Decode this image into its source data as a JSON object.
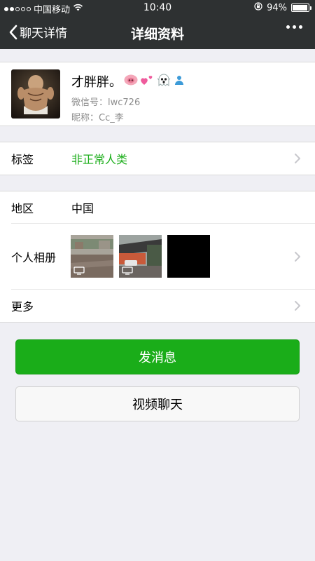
{
  "status_bar": {
    "carrier": "中国移动",
    "time": "10:40",
    "battery": "94%",
    "battery_level": 0.94,
    "signal_dots_filled": 2,
    "signal_dots_total": 5,
    "icons": [
      "signal-dots-icon",
      "wifi-icon",
      "orientation-lock-icon",
      "battery-icon"
    ]
  },
  "nav": {
    "back_label": "聊天详情",
    "title": "详细资料",
    "more_icon": "more-dots-icon"
  },
  "profile": {
    "name": "才胖胖。",
    "name_emojis": [
      "pig-nose-emoji",
      "two-hearts-emoji",
      "ghost-emoji",
      "gender-icon"
    ],
    "wechat_id_label": "微信号：",
    "wechat_id": "lwc726",
    "nickname_label": "昵称：",
    "nickname": "Cc_李"
  },
  "tag_row": {
    "label": "标签",
    "value": "非正常人类"
  },
  "details": {
    "region_label": "地区",
    "region_value": "中国",
    "album_label": "个人相册",
    "album_thumbnails": [
      "photo-street-rain",
      "photo-parking-lot",
      "photo-black"
    ],
    "more_label": "更多"
  },
  "actions": {
    "send_message": "发消息",
    "video_chat": "视频聊天"
  },
  "colors": {
    "nav_background": "#2e3132",
    "page_background": "#efeff4",
    "accent_green": "#1aad19",
    "secondary_text": "#8d8d8d"
  }
}
